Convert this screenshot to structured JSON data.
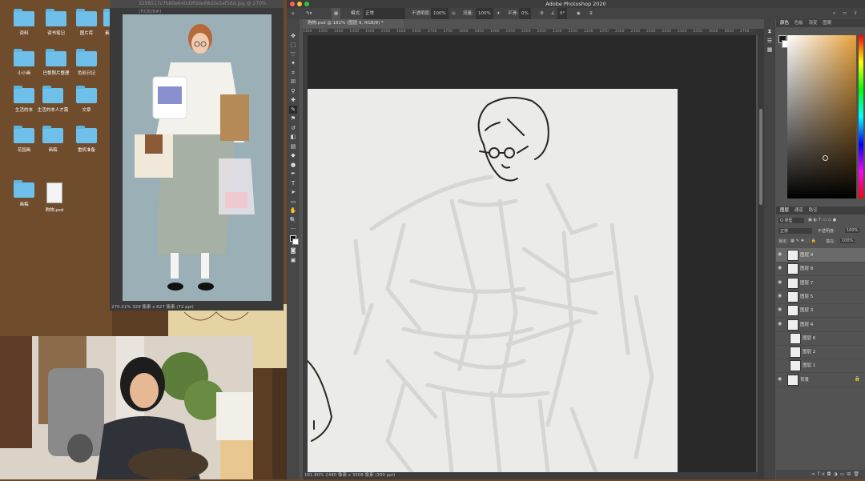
{
  "desktop": {
    "folders": [
      {
        "label": "资料"
      },
      {
        "label": "读书笔记"
      },
      {
        "label": "图片库"
      },
      {
        "label": "素材资料"
      },
      {
        "label": "小小画"
      },
      {
        "label": "巴黎照片整理"
      },
      {
        "label": "色彩日记"
      },
      {
        "label": "生活的本"
      },
      {
        "label": "生活的本人才需"
      },
      {
        "label": "文章"
      },
      {
        "label": "花园画"
      },
      {
        "label": "画稿"
      },
      {
        "label": "重机准备"
      }
    ],
    "dock_items": [
      {
        "label": "画稿"
      },
      {
        "label": "购物.psd"
      }
    ]
  },
  "preview": {
    "title": "3298517c7b80e640d9fdde68d3e5ef56d.jpg @ 270%(RGB/8#)",
    "status": "270.21%    329 像素 x 627 像素 (72 ppi)"
  },
  "photoshop": {
    "app_title": "Adobe Photoshop 2020",
    "options": {
      "mode_label": "模式:",
      "mode_value": "正常",
      "opacity_label": "不透明度:",
      "opacity_value": "100%",
      "flow_label": "流量:",
      "flow_value": "100%",
      "smooth_label": "平滑:",
      "smooth_value": "0%",
      "angle_value": "0°"
    },
    "doc_tab": "购物.psd @ 182% (图层 9, RGB/8) *",
    "ruler_ticks": [
      "1300",
      "1350",
      "1400",
      "1450",
      "1500",
      "1550",
      "1600",
      "1650",
      "1700",
      "1750",
      "1800",
      "1850",
      "1900",
      "1950",
      "2000",
      "2050",
      "2100",
      "2150",
      "2200",
      "2250",
      "2300",
      "2350",
      "2400",
      "2450",
      "2500",
      "2550",
      "2600",
      "2650",
      "2700"
    ],
    "status_bar": "181.80%    2480 像素 x 3508 像素 (300 ppi)",
    "color_panel_tabs": [
      "颜色",
      "色板",
      "渐变",
      "图案"
    ],
    "layers_panel_tabs": [
      "图层",
      "通道",
      "路径"
    ],
    "layers_controls": {
      "kind_label": "Q 类型",
      "blend_mode": "正常",
      "opacity_label": "不透明度:",
      "opacity_value": "100%",
      "lock_label": "锁定:",
      "fill_label": "填充:",
      "fill_value": "100%"
    },
    "layers": [
      {
        "name": "图层 9",
        "selected": true,
        "visible": true
      },
      {
        "name": "图层 8",
        "selected": false,
        "visible": true
      },
      {
        "name": "图层 7",
        "selected": false,
        "visible": true
      },
      {
        "name": "图层 5",
        "selected": false,
        "visible": true
      },
      {
        "name": "图层 3",
        "selected": false,
        "visible": true
      },
      {
        "name": "图层 4",
        "selected": false,
        "visible": true
      },
      {
        "name": "图层 6",
        "selected": false,
        "visible": false
      },
      {
        "name": "图层 2",
        "selected": false,
        "visible": false
      },
      {
        "name": "图层 1",
        "selected": false,
        "visible": false
      },
      {
        "name": "背景",
        "selected": false,
        "visible": true
      }
    ]
  },
  "colors": {
    "ps_bg": "#535353",
    "canvas_bg": "#ebebea",
    "desktop_bg": "#6e4c2c",
    "folder_blue": "#6ec0ea"
  }
}
